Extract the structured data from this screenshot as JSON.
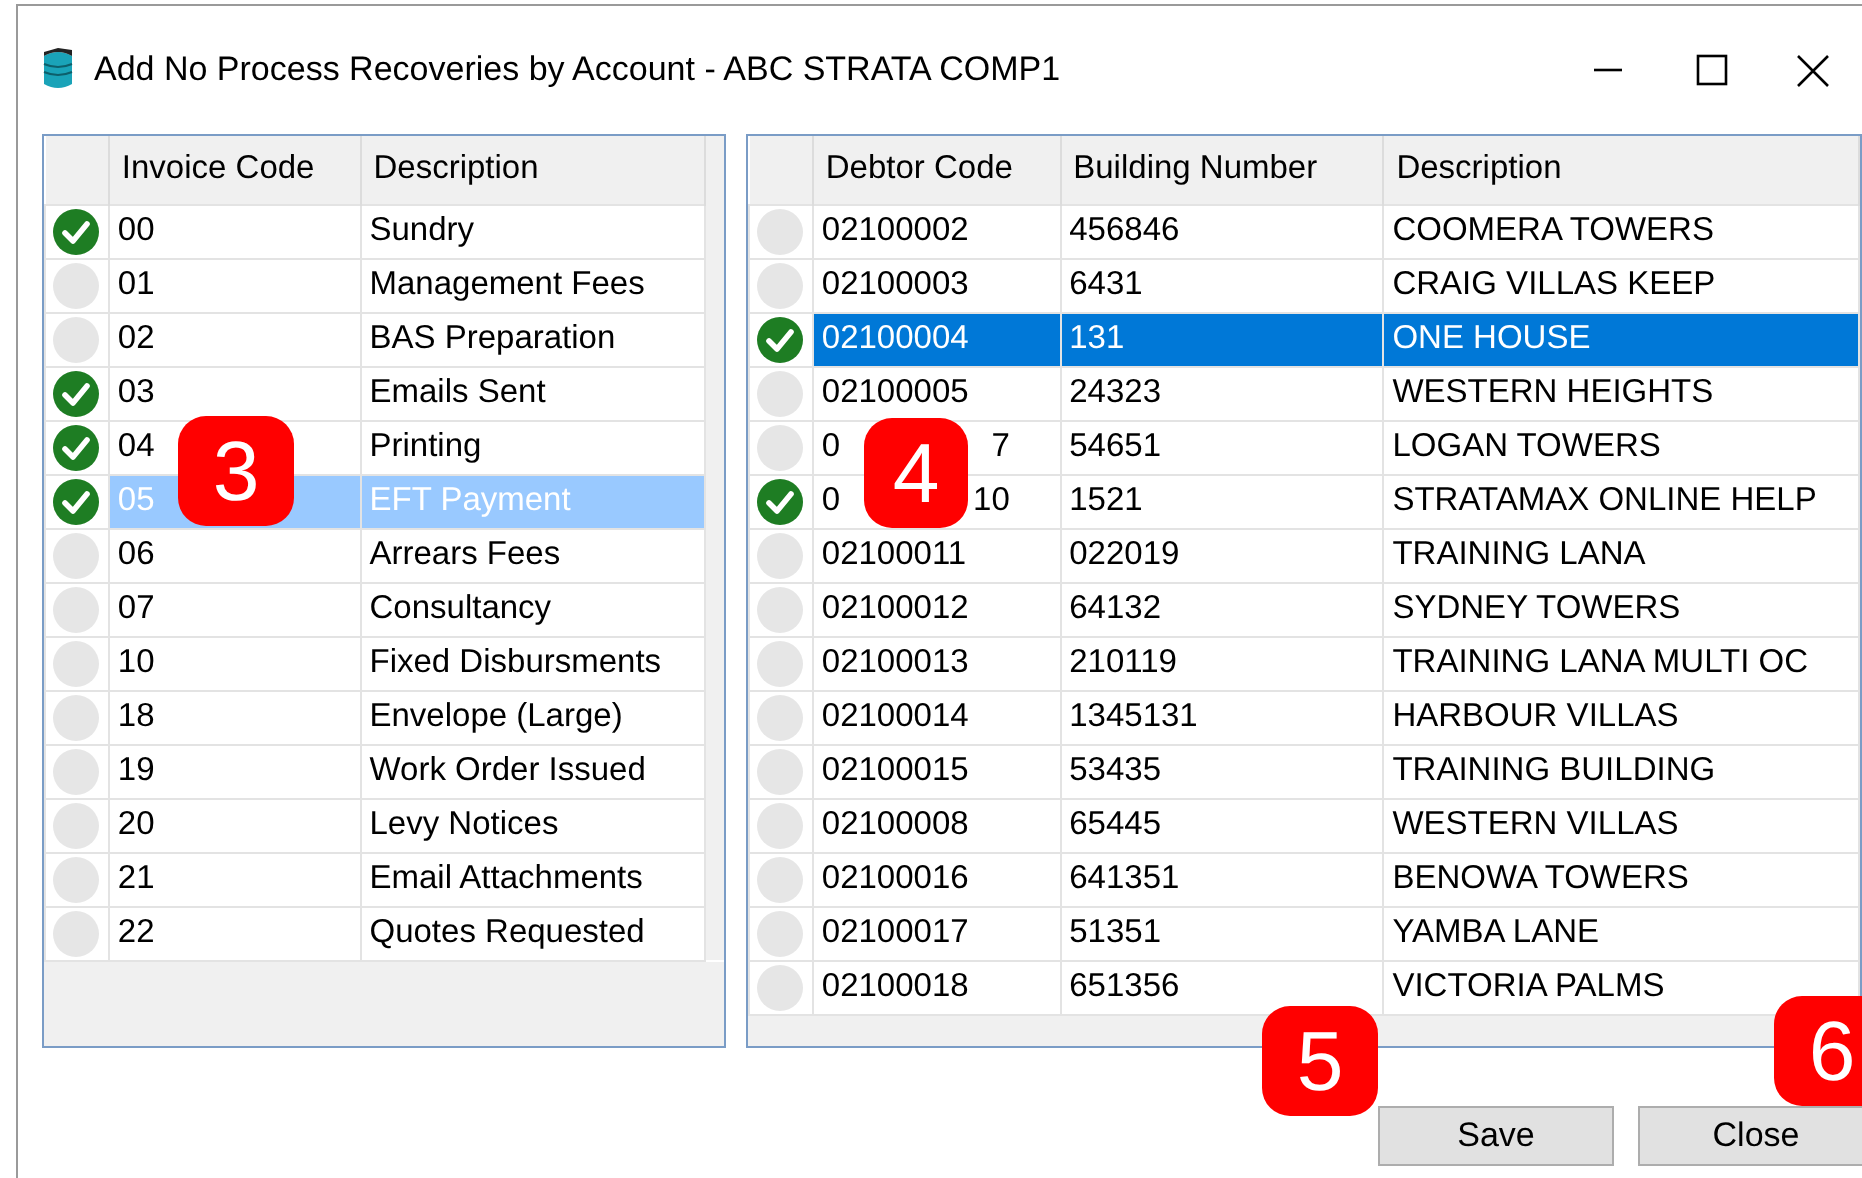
{
  "window": {
    "title": "Add No Process Recoveries by Account - ABC STRATA COMP1"
  },
  "invoice_table": {
    "columns": [
      "Invoice Code",
      "Description"
    ],
    "rows": [
      {
        "code": "00",
        "description": "Sundry",
        "checked": true,
        "selected": false
      },
      {
        "code": "01",
        "description": "Management Fees",
        "checked": false,
        "selected": false
      },
      {
        "code": "02",
        "description": "BAS Preparation",
        "checked": false,
        "selected": false
      },
      {
        "code": "03",
        "description": "Emails Sent",
        "checked": true,
        "selected": false
      },
      {
        "code": "04",
        "description": "Printing",
        "checked": true,
        "selected": false
      },
      {
        "code": "05",
        "description": "EFT Payment",
        "checked": true,
        "selected": true
      },
      {
        "code": "06",
        "description": "Arrears Fees",
        "checked": false,
        "selected": false
      },
      {
        "code": "07",
        "description": "Consultancy",
        "checked": false,
        "selected": false
      },
      {
        "code": "10",
        "description": "Fixed Disbursments",
        "checked": false,
        "selected": false
      },
      {
        "code": "18",
        "description": "Envelope (Large)",
        "checked": false,
        "selected": false
      },
      {
        "code": "19",
        "description": "Work Order Issued",
        "checked": false,
        "selected": false
      },
      {
        "code": "20",
        "description": "Levy Notices",
        "checked": false,
        "selected": false
      },
      {
        "code": "21",
        "description": "Email Attachments",
        "checked": false,
        "selected": false
      },
      {
        "code": "22",
        "description": "Quotes Requested",
        "checked": false,
        "selected": false
      }
    ]
  },
  "debtor_table": {
    "columns": [
      "Debtor Code",
      "Building Number",
      "Description"
    ],
    "rows": [
      {
        "code": "02100002",
        "building": "456846",
        "description": "COOMERA TOWERS",
        "checked": false,
        "selected": false
      },
      {
        "code": "02100003",
        "building": "6431",
        "description": "CRAIG VILLAS KEEP",
        "checked": false,
        "selected": false
      },
      {
        "code": "02100004",
        "building": "131",
        "description": "ONE HOUSE",
        "checked": true,
        "selected": true
      },
      {
        "code": "02100005",
        "building": "24323",
        "description": "WESTERN HEIGHTS",
        "checked": false,
        "selected": false
      },
      {
        "code": "0",
        "code_tail": "7",
        "building": "54651",
        "description": "LOGAN TOWERS",
        "checked": false,
        "selected": false
      },
      {
        "code": "0",
        "code_tail": "10",
        "building": "1521",
        "description": "STRATAMAX ONLINE HELP",
        "checked": true,
        "selected": false
      },
      {
        "code": "02100011",
        "building": "022019",
        "description": "TRAINING LANA",
        "checked": false,
        "selected": false
      },
      {
        "code": "02100012",
        "building": "64132",
        "description": "SYDNEY TOWERS",
        "checked": false,
        "selected": false
      },
      {
        "code": "02100013",
        "building": "210119",
        "description": "TRAINING LANA MULTI OC",
        "checked": false,
        "selected": false
      },
      {
        "code": "02100014",
        "building": "1345131",
        "description": "HARBOUR VILLAS",
        "checked": false,
        "selected": false
      },
      {
        "code": "02100015",
        "building": "53435",
        "description": "TRAINING BUILDING",
        "checked": false,
        "selected": false
      },
      {
        "code": "02100008",
        "building": "65445",
        "description": "WESTERN VILLAS",
        "checked": false,
        "selected": false
      },
      {
        "code": "02100016",
        "building": "641351",
        "description": "BENOWA TOWERS",
        "checked": false,
        "selected": false
      },
      {
        "code": "02100017",
        "building": "51351",
        "description": "YAMBA LANE",
        "checked": false,
        "selected": false
      },
      {
        "code": "02100018",
        "building": "651356",
        "description": "VICTORIA PALMS",
        "checked": false,
        "selected": false
      }
    ]
  },
  "buttons": [
    "Save",
    "Close"
  ],
  "callouts": [
    "3",
    "4",
    "5",
    "6"
  ]
}
